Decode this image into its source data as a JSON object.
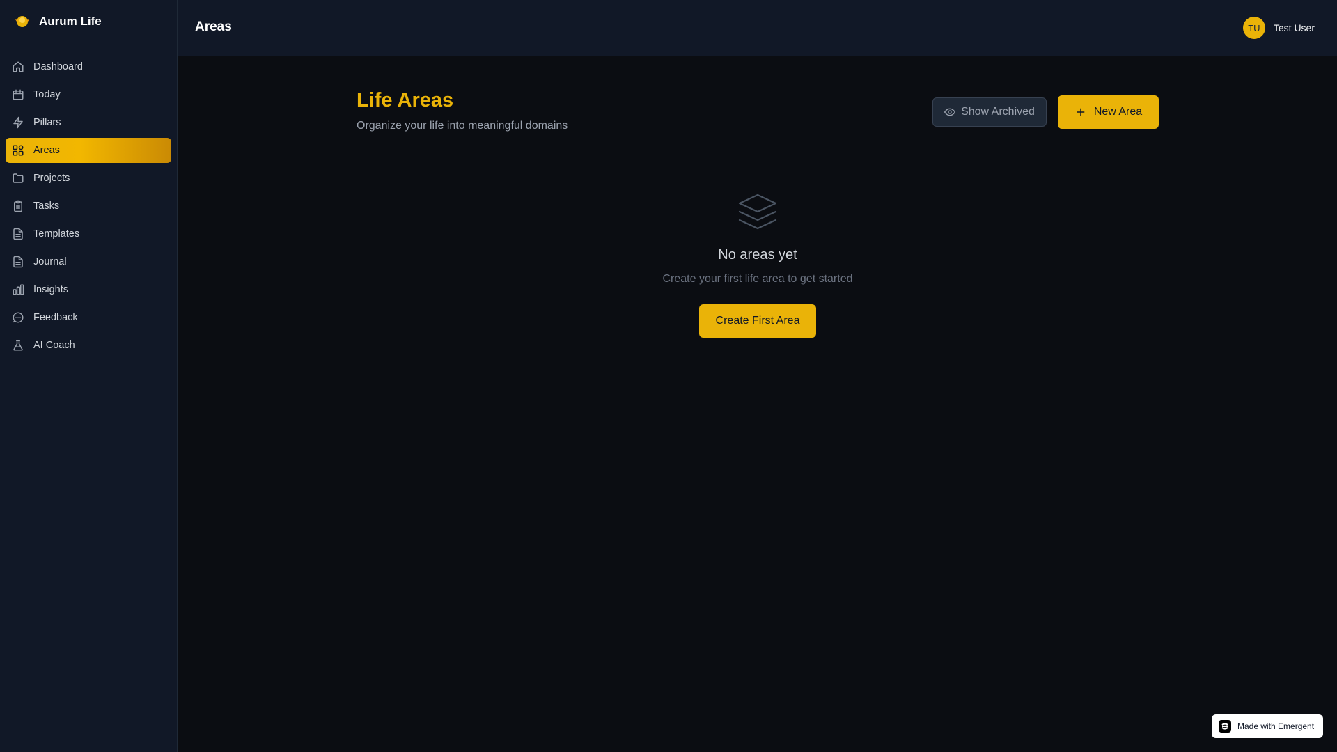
{
  "app": {
    "name": "Aurum Life"
  },
  "colors": {
    "accent": "#eab308",
    "background": "#0b0d12",
    "sidebar": "#111827"
  },
  "sidebar": {
    "items": [
      {
        "label": "Dashboard",
        "icon": "home-icon",
        "active": false
      },
      {
        "label": "Today",
        "icon": "calendar-icon",
        "active": false
      },
      {
        "label": "Pillars",
        "icon": "lightning-icon",
        "active": false
      },
      {
        "label": "Areas",
        "icon": "grid-icon",
        "active": true
      },
      {
        "label": "Projects",
        "icon": "folder-icon",
        "active": false
      },
      {
        "label": "Tasks",
        "icon": "clipboard-icon",
        "active": false
      },
      {
        "label": "Templates",
        "icon": "document-icon",
        "active": false
      },
      {
        "label": "Journal",
        "icon": "document-icon",
        "active": false
      },
      {
        "label": "Insights",
        "icon": "bar-chart-icon",
        "active": false
      },
      {
        "label": "Feedback",
        "icon": "chat-icon",
        "active": false
      },
      {
        "label": "AI Coach",
        "icon": "flask-icon",
        "active": false
      }
    ]
  },
  "header": {
    "title": "Areas",
    "user": {
      "initials": "TU",
      "name": "Test User"
    }
  },
  "main": {
    "title": "Life Areas",
    "subtitle": "Organize your life into meaningful domains",
    "show_archived_label": "Show Archived",
    "new_area_label": "New Area",
    "empty": {
      "icon": "layers-icon",
      "title": "No areas yet",
      "subtitle": "Create your first life area to get started",
      "button_label": "Create First Area"
    }
  },
  "badge": {
    "label": "Made with Emergent"
  }
}
